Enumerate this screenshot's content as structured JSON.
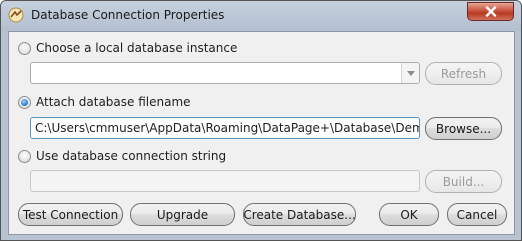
{
  "window": {
    "title": "Database Connection Properties"
  },
  "local_instance": {
    "label": "Choose a local database instance",
    "selected": false,
    "value": "",
    "refresh_label": "Refresh"
  },
  "attach_file": {
    "label": "Attach database filename",
    "selected": true,
    "value": "C:\\Users\\cmmuser\\AppData\\Roaming\\DataPage+\\Database\\Demo.mdf",
    "browse_label": "Browse..."
  },
  "connection_string": {
    "label": "Use database connection string",
    "selected": false,
    "value": "",
    "build_label": "Build..."
  },
  "footer": {
    "test_connection_label": "Test Connection",
    "upgrade_label": "Upgrade",
    "create_database_label": "Create Database...",
    "ok_label": "OK",
    "cancel_label": "Cancel"
  },
  "colors": {
    "titlebar": "#b9c5d6",
    "close_button": "#c9533e",
    "client_background": "#f0f0f0",
    "radio_selected": "#2f7fd3"
  },
  "icons": {
    "app": "database-connection-icon",
    "close": "close-icon",
    "dropdown": "chevron-down-icon"
  }
}
